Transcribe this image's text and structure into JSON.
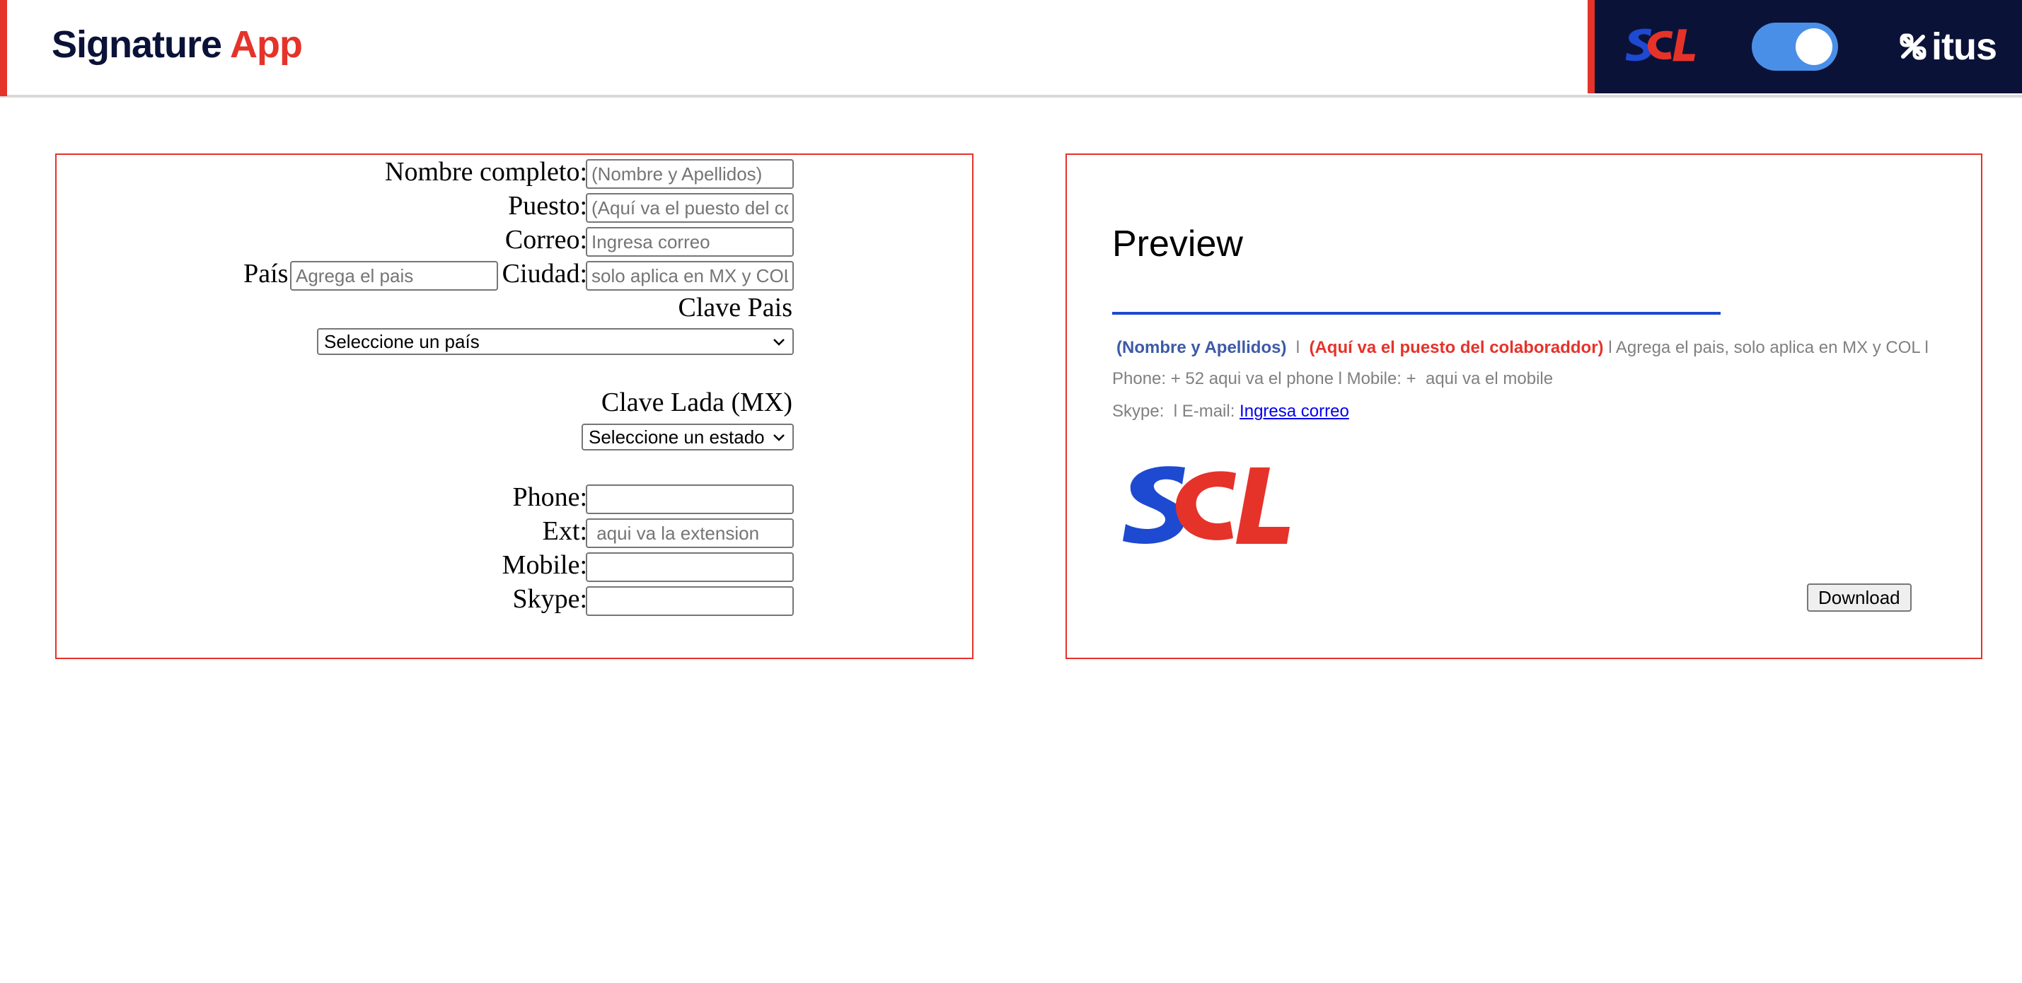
{
  "header": {
    "title_main": "Signature",
    "title_accent": "App",
    "brand_logo_text": "itus",
    "colors": {
      "navy": "#0b1238",
      "red": "#e5332a",
      "blue": "#1e49d1",
      "toggle": "#4a8fe7"
    }
  },
  "form": {
    "labels": {
      "nombre": "Nombre completo:",
      "puesto": "Puesto:",
      "correo": "Correo:",
      "pais": "País:",
      "ciudad": "Ciudad:",
      "clave_pais": "Clave Pais",
      "clave_lada": "Clave Lada (MX)",
      "phone": "Phone:",
      "ext": "Ext:",
      "mobile": "Mobile:",
      "skype": "Skype:"
    },
    "placeholders": {
      "nombre": "(Nombre y Apellidos)",
      "puesto": "(Aquí va el puesto del colaboraddor)",
      "correo": "Ingresa correo",
      "pais": "Agrega el pais",
      "ciudad": "solo aplica en MX y COL",
      "phone": "",
      "ext": " aqui va la extension",
      "mobile": "",
      "skype": ""
    },
    "select_pais": "Seleccione un país",
    "select_estado": "Seleccione un estado"
  },
  "preview": {
    "title": "Preview",
    "name": "(Nombre y Apellidos)",
    "sep1": "  l  ",
    "position": "(Aquí va el puesto del colaboraddor)",
    "location": " l Agrega el pais, solo aplica en MX y COL l",
    "phone_line": "Phone: + 52 aqui va el phone l Mobile: +  aqui va el mobile",
    "skype_line": "Skype:  l E-mail: ",
    "email": "Ingresa correo",
    "download_label": "Download"
  }
}
